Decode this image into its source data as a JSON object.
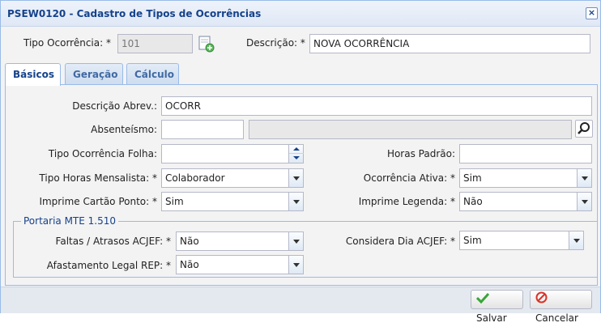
{
  "window": {
    "title": "PSEW0120 - Cadastro de Tipos de Ocorrências",
    "close": "×"
  },
  "header": {
    "tipo_label": "Tipo Ocorrência: *",
    "tipo_value": "101",
    "descricao_label": "Descrição: *",
    "descricao_value": "NOVA OCORRÊNCIA"
  },
  "tabs": [
    {
      "label": "Básicos",
      "active": true
    },
    {
      "label": "Geração",
      "active": false
    },
    {
      "label": "Cálculo",
      "active": false
    }
  ],
  "basicos": {
    "desc_abrev_label": "Descrição Abrev.:",
    "desc_abrev_value": "OCORR",
    "absenteismo_label": "Absenteísmo:",
    "absenteismo_code": "",
    "absenteismo_desc": "",
    "tipo_folha_label": "Tipo Ocorrência Folha:",
    "tipo_folha_value": "",
    "horas_padrao_label": "Horas Padrão:",
    "horas_padrao_value": "",
    "tipo_horas_label": "Tipo Horas Mensalista: *",
    "tipo_horas_value": "Colaborador",
    "ocorrencia_ativa_label": "Ocorrência Ativa: *",
    "ocorrencia_ativa_value": "Sim",
    "imprime_cartao_label": "Imprime Cartão Ponto: *",
    "imprime_cartao_value": "Sim",
    "imprime_legenda_label": "Imprime Legenda: *",
    "imprime_legenda_value": "Não"
  },
  "portaria": {
    "legend": "Portaria MTE 1.510",
    "faltas_label": "Faltas / Atrasos ACJEF: *",
    "faltas_value": "Não",
    "considera_label": "Considera Dia ACJEF: *",
    "considera_value": "Sim",
    "afastamento_label": "Afastamento Legal REP: *",
    "afastamento_value": "Não"
  },
  "footer": {
    "save_label": "Salvar",
    "cancel_label": "Cancelar"
  },
  "colors": {
    "title": "#15428b",
    "border": "#99bbe8",
    "save_check": "#3aa53a",
    "cancel_red": "#d9342b"
  }
}
